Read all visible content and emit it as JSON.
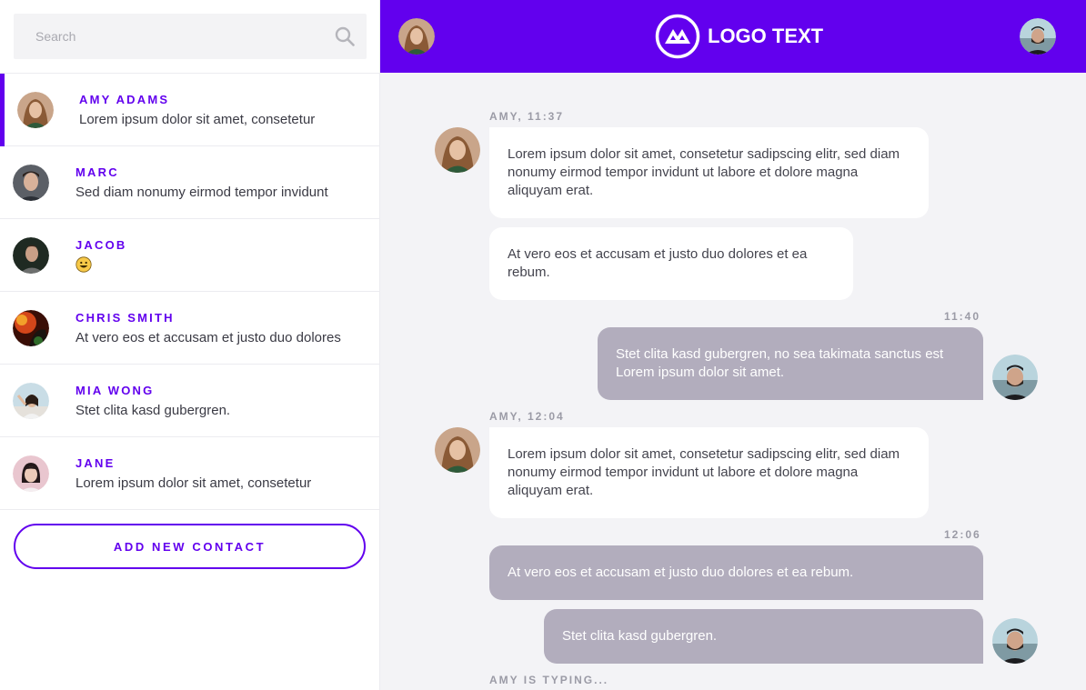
{
  "search": {
    "placeholder": "Search",
    "icon": "search-icon"
  },
  "colors": {
    "accent": "#6200ee",
    "outgoing_bubble": "#b2adbd",
    "chat_bg": "#f3f3f6"
  },
  "contacts": [
    {
      "name": "Amy Adams",
      "preview": "Lorem ipsum dolor sit amet, consetetur",
      "active": true
    },
    {
      "name": "Marc",
      "preview": "Sed diam nonumy eirmod tempor invidunt"
    },
    {
      "name": "Jacob",
      "preview": "",
      "emoji": "grinning-face-emoji"
    },
    {
      "name": "Chris Smith",
      "preview": "At vero eos et accusam et justo duo dolores"
    },
    {
      "name": "Mia Wong",
      "preview": "Stet clita kasd gubergren."
    },
    {
      "name": "Jane",
      "preview": "Lorem ipsum dolor sit amet, consetetur"
    }
  ],
  "add_contact_label": "ADD NEW CONTACT",
  "header": {
    "logo_text": "LOGO TEXT"
  },
  "messages": [
    {
      "meta": "AMY, 11:37",
      "text": "Lorem ipsum dolor sit amet, consetetur sadipscing elitr, sed diam nonumy eirmod tempor invidunt ut labore et dolore magna aliquyam erat.",
      "direction": "in"
    },
    {
      "text": "At vero eos et accusam et justo duo dolores et ea rebum.",
      "direction": "in"
    },
    {
      "meta": "11:40",
      "text": "Stet clita kasd gubergren, no sea takimata sanctus est Lorem ipsum dolor sit amet.",
      "direction": "out"
    },
    {
      "meta": "AMY, 12:04",
      "text": "Lorem ipsum dolor sit amet, consetetur sadipscing elitr, sed diam nonumy eirmod tempor invidunt ut labore et dolore magna aliquyam erat.",
      "direction": "in"
    },
    {
      "meta": "12:06",
      "text": "At vero eos et accusam et justo duo dolores et ea rebum.",
      "direction": "out"
    },
    {
      "text": "Stet clita kasd gubergren.",
      "direction": "out"
    }
  ],
  "typing_indicator": "AMY IS TYPING..."
}
